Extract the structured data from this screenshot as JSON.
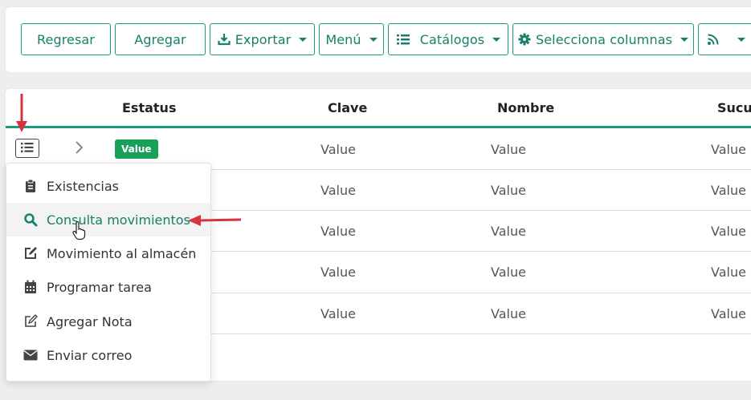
{
  "toolbar": {
    "back_label": "Regresar",
    "add_label": "Agregar",
    "export_label": "Exportar",
    "menu_label": "Menú",
    "catalogs_label": "Catálogos",
    "columns_label": "Selecciona columnas"
  },
  "table": {
    "headers": [
      "Estatus",
      "Clave",
      "Nombre",
      "Sucur"
    ],
    "rows": [
      {
        "status": "Value",
        "clave": "Value",
        "nombre": "Value",
        "sucursal": "Value"
      },
      {
        "clave": "Value",
        "nombre": "Value",
        "sucursal": "Value"
      },
      {
        "clave": "Value",
        "nombre": "Value",
        "sucursal": "Value"
      },
      {
        "clave": "Value",
        "nombre": "Value",
        "sucursal": "Value"
      },
      {
        "clave": "Value",
        "nombre": "Value",
        "sucursal": "Value"
      }
    ]
  },
  "context_menu": {
    "items": [
      {
        "label": "Existencias",
        "icon": "clipboard-icon"
      },
      {
        "label": "Consulta movimientos",
        "icon": "search-icon",
        "active": true
      },
      {
        "label": "Movimiento al almacén",
        "icon": "edit-icon"
      },
      {
        "label": "Programar tarea",
        "icon": "calendar-icon"
      },
      {
        "label": "Agregar Nota",
        "icon": "note-icon"
      },
      {
        "label": "Enviar correo",
        "icon": "envelope-icon"
      }
    ]
  },
  "colors": {
    "accent": "#1a9c7c",
    "status_green": "#17a05a",
    "annotation_red": "#d9333f"
  }
}
